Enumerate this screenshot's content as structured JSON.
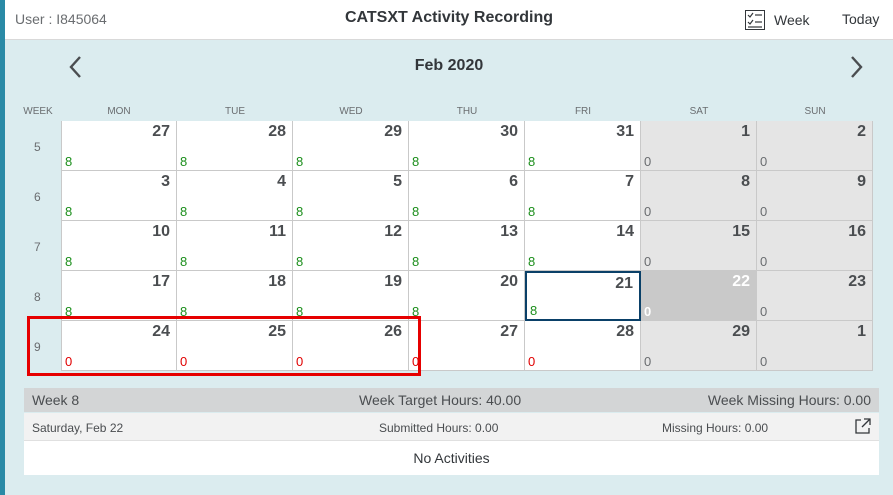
{
  "header": {
    "user": "User : I845064",
    "title": "CATSXT Activity Recording",
    "week_button": "Week",
    "week_icon": "checklist-icon",
    "today_button": "Today"
  },
  "calendar": {
    "month_label": "Feb 2020",
    "week_col_label": "WEEK",
    "day_headers": [
      "MON",
      "TUE",
      "WED",
      "THU",
      "FRI",
      "SAT",
      "SUN"
    ],
    "weeks": [
      {
        "week": "5",
        "days": [
          {
            "day": "27",
            "hours": "8",
            "status": "green"
          },
          {
            "day": "28",
            "hours": "8",
            "status": "green"
          },
          {
            "day": "29",
            "hours": "8",
            "status": "green"
          },
          {
            "day": "30",
            "hours": "8",
            "status": "green"
          },
          {
            "day": "31",
            "hours": "8",
            "status": "green"
          },
          {
            "day": "1",
            "hours": "0",
            "status": "weekend"
          },
          {
            "day": "2",
            "hours": "0",
            "status": "weekend"
          }
        ]
      },
      {
        "week": "6",
        "days": [
          {
            "day": "3",
            "hours": "8",
            "status": "green"
          },
          {
            "day": "4",
            "hours": "8",
            "status": "green"
          },
          {
            "day": "5",
            "hours": "8",
            "status": "green"
          },
          {
            "day": "6",
            "hours": "8",
            "status": "green"
          },
          {
            "day": "7",
            "hours": "8",
            "status": "green"
          },
          {
            "day": "8",
            "hours": "0",
            "status": "weekend"
          },
          {
            "day": "9",
            "hours": "0",
            "status": "weekend"
          }
        ]
      },
      {
        "week": "7",
        "days": [
          {
            "day": "10",
            "hours": "8",
            "status": "green"
          },
          {
            "day": "11",
            "hours": "8",
            "status": "green"
          },
          {
            "day": "12",
            "hours": "8",
            "status": "green"
          },
          {
            "day": "13",
            "hours": "8",
            "status": "green"
          },
          {
            "day": "14",
            "hours": "8",
            "status": "green"
          },
          {
            "day": "15",
            "hours": "0",
            "status": "weekend"
          },
          {
            "day": "16",
            "hours": "0",
            "status": "weekend"
          }
        ]
      },
      {
        "week": "8",
        "days": [
          {
            "day": "17",
            "hours": "8",
            "status": "green"
          },
          {
            "day": "18",
            "hours": "8",
            "status": "green"
          },
          {
            "day": "19",
            "hours": "8",
            "status": "green"
          },
          {
            "day": "20",
            "hours": "8",
            "status": "green"
          },
          {
            "day": "21",
            "hours": "8",
            "status": "today"
          },
          {
            "day": "22",
            "hours": "0",
            "status": "selected"
          },
          {
            "day": "23",
            "hours": "0",
            "status": "weekend"
          }
        ]
      },
      {
        "week": "9",
        "days": [
          {
            "day": "24",
            "hours": "0",
            "status": "red"
          },
          {
            "day": "25",
            "hours": "0",
            "status": "red"
          },
          {
            "day": "26",
            "hours": "0",
            "status": "red"
          },
          {
            "day": "27",
            "hours": "0",
            "status": "red"
          },
          {
            "day": "28",
            "hours": "0",
            "status": "red"
          },
          {
            "day": "29",
            "hours": "0",
            "status": "weekend"
          },
          {
            "day": "1",
            "hours": "0",
            "status": "weekend"
          }
        ]
      }
    ]
  },
  "summary": {
    "week_label": "Week 8",
    "target_hours": "Week Target Hours: 40.00",
    "missing_hours": "Week Missing Hours: 0.00"
  },
  "detail": {
    "date": "Saturday, Feb 22",
    "submitted": "Submitted Hours: 0.00",
    "missing": "Missing Hours: 0.00",
    "export_icon": "export-icon"
  },
  "activities": {
    "empty_text": "No Activities"
  }
}
